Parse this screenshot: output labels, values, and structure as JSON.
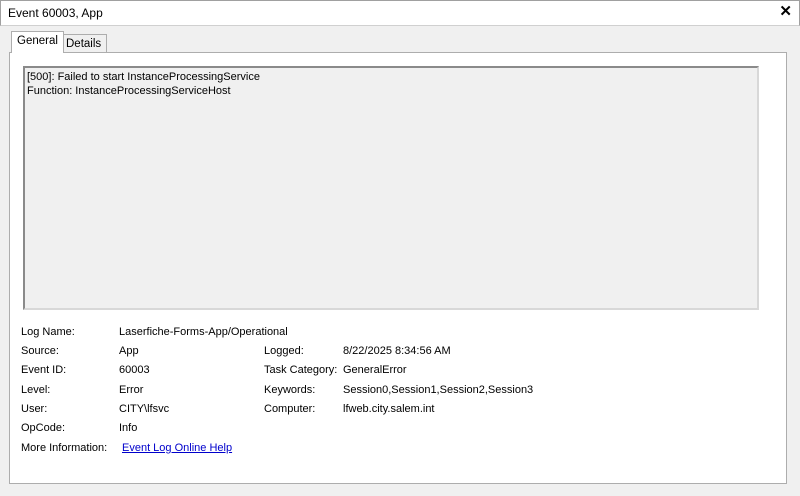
{
  "window": {
    "title": "Event 60003, App",
    "close_glyph": "✕"
  },
  "tabs": [
    {
      "label": "General",
      "active": true
    },
    {
      "label": "Details",
      "active": false
    }
  ],
  "description": {
    "line1": "[500]: Failed to start InstanceProcessingService",
    "line2": "Function: InstanceProcessingServiceHost"
  },
  "fields": {
    "log_name": {
      "label": "Log Name:",
      "value": "Laserfiche-Forms-App/Operational"
    },
    "source": {
      "label": "Source:",
      "value": "App"
    },
    "logged": {
      "label": "Logged:",
      "value": "8/22/2025 8:34:56 AM"
    },
    "event_id": {
      "label": "Event ID:",
      "value": "60003"
    },
    "task_category": {
      "label": "Task Category:",
      "value": "GeneralError"
    },
    "level": {
      "label": "Level:",
      "value": "Error"
    },
    "keywords": {
      "label": "Keywords:",
      "value": "Session0,Session1,Session2,Session3"
    },
    "user": {
      "label": "User:",
      "value": "CITY\\lfsvc"
    },
    "computer": {
      "label": "Computer:",
      "value": "lfweb.city.salem.int"
    },
    "opcode": {
      "label": "OpCode:",
      "value": "Info"
    },
    "more_info": {
      "label": "More Information:",
      "link": "Event Log Online Help"
    }
  }
}
